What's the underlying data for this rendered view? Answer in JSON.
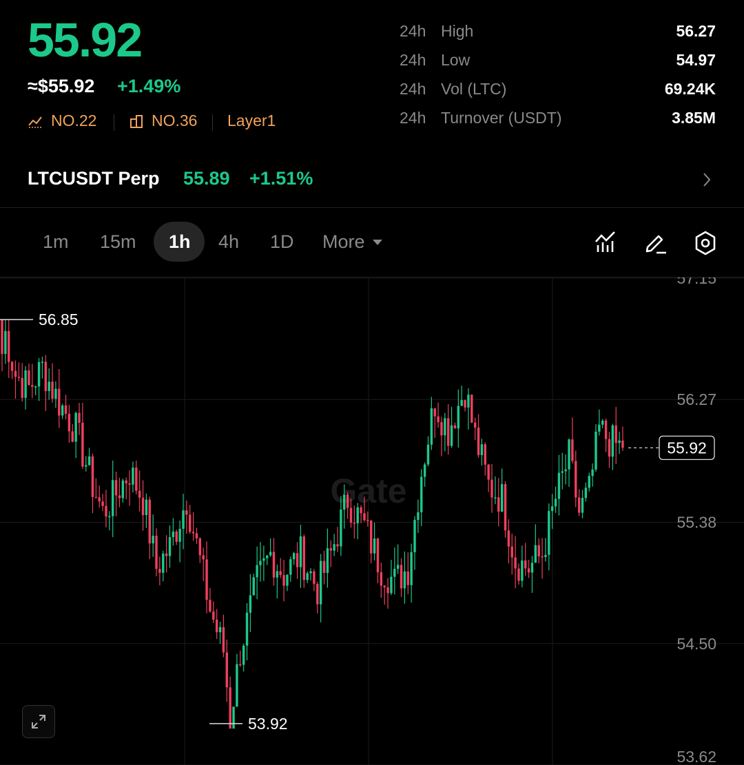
{
  "ticker": {
    "price": "55.92",
    "usd_price": "≈$55.92",
    "change_pct": "+1.49%",
    "rank_market_cap": "NO.22",
    "rank_sector": "NO.36",
    "sector_tag": "Layer1"
  },
  "stats": [
    {
      "period": "24h",
      "label": "High",
      "value": "56.27"
    },
    {
      "period": "24h",
      "label": "Low",
      "value": "54.97"
    },
    {
      "period": "24h",
      "label": "Vol (LTC)",
      "value": "69.24K"
    },
    {
      "period": "24h",
      "label": "Turnover (USDT)",
      "value": "3.85M"
    }
  ],
  "perp": {
    "name": "LTCUSDT Perp",
    "price": "55.89",
    "change_pct": "+1.51%"
  },
  "timeframes": {
    "items": [
      "1m",
      "15m",
      "1h",
      "4h",
      "1D"
    ],
    "active": "1h",
    "more_label": "More"
  },
  "toolbar_icons": [
    "indicators-icon",
    "draw-icon",
    "settings-icon"
  ],
  "colors": {
    "up": "#1cc98a",
    "down": "#f0405e",
    "accent": "#f0a35a",
    "background": "#000000"
  },
  "chart_data": {
    "type": "candlestick",
    "interval": "1h",
    "y_axis_labels": [
      "57.15",
      "56.27",
      "55.38",
      "54.50",
      "53.62"
    ],
    "ylim": [
      53.62,
      57.15
    ],
    "max_marker": "56.85",
    "min_marker": "53.92",
    "last_price_label": "55.92",
    "watermark": "Gate",
    "close_waypoints": [
      [
        0,
        56.85
      ],
      [
        4,
        56.45
      ],
      [
        8,
        56.35
      ],
      [
        12,
        56.5
      ],
      [
        17,
        56.25
      ],
      [
        22,
        56.05
      ],
      [
        27,
        55.65
      ],
      [
        30,
        55.45
      ],
      [
        33,
        55.55
      ],
      [
        38,
        55.75
      ],
      [
        42,
        55.55
      ],
      [
        46,
        55.05
      ],
      [
        50,
        55.2
      ],
      [
        55,
        55.55
      ],
      [
        59,
        55.1
      ],
      [
        62,
        54.75
      ],
      [
        66,
        54.45
      ],
      [
        68,
        53.95
      ],
      [
        71,
        54.45
      ],
      [
        76,
        54.95
      ],
      [
        80,
        55.15
      ],
      [
        84,
        55.0
      ],
      [
        89,
        55.15
      ],
      [
        94,
        54.9
      ],
      [
        98,
        55.15
      ],
      [
        103,
        55.55
      ],
      [
        108,
        55.35
      ],
      [
        113,
        55.05
      ],
      [
        117,
        54.95
      ],
      [
        121,
        55.05
      ],
      [
        125,
        55.75
      ],
      [
        129,
        56.25
      ],
      [
        133,
        56.05
      ],
      [
        138,
        56.35
      ],
      [
        141,
        56.0
      ],
      [
        145,
        55.65
      ],
      [
        149,
        55.55
      ],
      [
        153,
        55.1
      ],
      [
        157,
        55.05
      ],
      [
        161,
        55.15
      ],
      [
        165,
        55.55
      ],
      [
        169,
        55.85
      ],
      [
        172,
        55.45
      ],
      [
        175,
        55.6
      ],
      [
        178,
        56.05
      ],
      [
        182,
        55.95
      ],
      [
        185,
        55.92
      ]
    ]
  }
}
